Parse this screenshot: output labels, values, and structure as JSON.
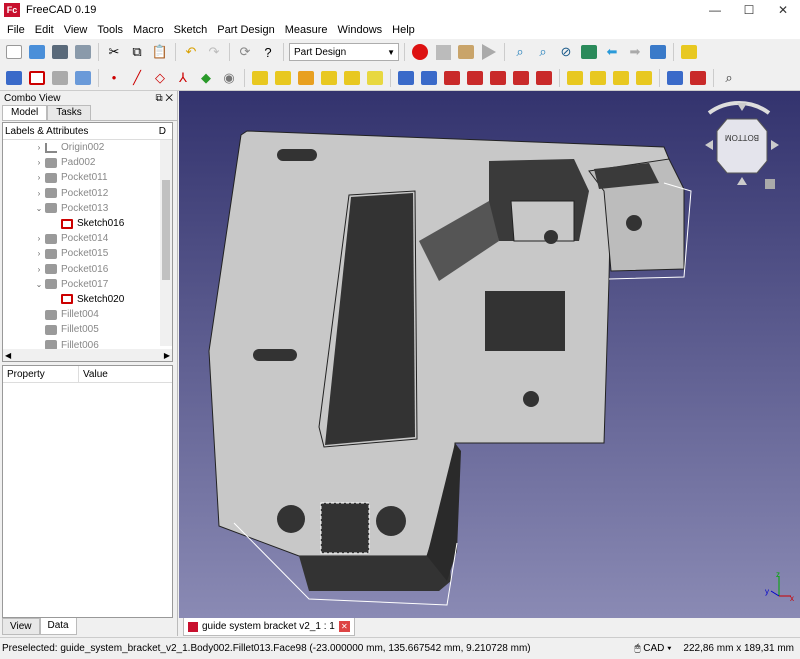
{
  "window": {
    "title": "FreeCAD 0.19",
    "minimize": "—",
    "maximize": "☐",
    "close": "✕"
  },
  "menu": [
    "File",
    "Edit",
    "View",
    "Tools",
    "Macro",
    "Sketch",
    "Part Design",
    "Measure",
    "Windows",
    "Help"
  ],
  "toolbar": {
    "workbench": "Part Design"
  },
  "combo": {
    "title": "Combo View",
    "tabs": [
      "Model",
      "Tasks"
    ],
    "tree_header": "Labels & Attributes",
    "tree_items": [
      {
        "label": "Origin002",
        "icon": "origin-icon",
        "expand": "›",
        "active": false
      },
      {
        "label": "Pad002",
        "icon": "feature-icon",
        "expand": "›",
        "active": false
      },
      {
        "label": "Pocket011",
        "icon": "feature-icon",
        "expand": "›",
        "active": false
      },
      {
        "label": "Pocket012",
        "icon": "feature-icon",
        "expand": "›",
        "active": false
      },
      {
        "label": "Pocket013",
        "icon": "feature-icon",
        "expand": "⌄",
        "active": false
      },
      {
        "label": "Sketch016",
        "icon": "sketch-icon",
        "expand": "",
        "active": true
      },
      {
        "label": "Pocket014",
        "icon": "feature-icon",
        "expand": "›",
        "active": false
      },
      {
        "label": "Pocket015",
        "icon": "feature-icon",
        "expand": "›",
        "active": false
      },
      {
        "label": "Pocket016",
        "icon": "feature-icon",
        "expand": "›",
        "active": false
      },
      {
        "label": "Pocket017",
        "icon": "feature-icon",
        "expand": "⌄",
        "active": false
      },
      {
        "label": "Sketch020",
        "icon": "sketch-icon",
        "expand": "",
        "active": true
      },
      {
        "label": "Fillet004",
        "icon": "feature-icon",
        "expand": "",
        "active": false
      },
      {
        "label": "Fillet005",
        "icon": "feature-icon",
        "expand": "",
        "active": false
      },
      {
        "label": "Fillet006",
        "icon": "feature-icon",
        "expand": "",
        "active": false
      }
    ],
    "prop_cols": [
      "Property",
      "Value"
    ],
    "bottom_tabs": [
      "View",
      "Data"
    ]
  },
  "navcube": {
    "face": "BOTTOM"
  },
  "doc_tab": {
    "label": "guide system bracket v2_1 : 1"
  },
  "status": {
    "preselected": "Preselected: guide_system_bracket_v2_1.Body002.Fillet013.Face98 (-23.000000 mm, 135.667542 mm, 9.210728 mm)",
    "nav_style": "CAD",
    "dimensions": "222,86 mm x 189,31 mm"
  }
}
